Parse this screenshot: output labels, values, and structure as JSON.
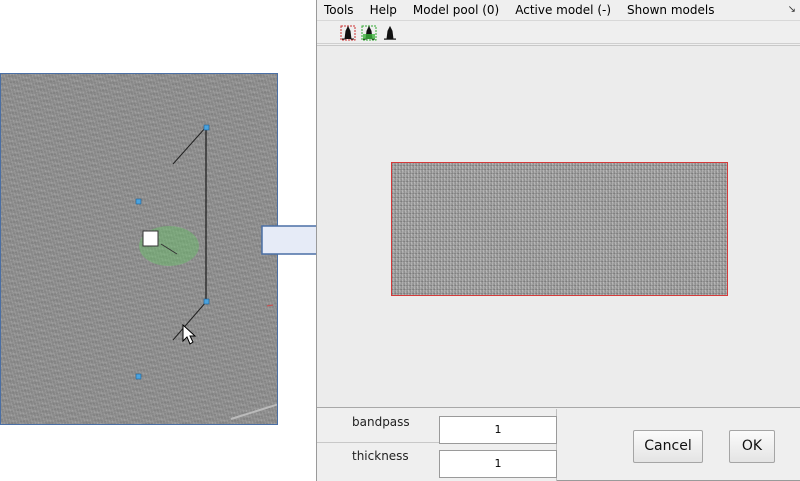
{
  "menubar": {
    "items": [
      {
        "label": "Tools"
      },
      {
        "label": "Help"
      },
      {
        "label": "Model pool (0)"
      },
      {
        "label": "Active model (-)"
      },
      {
        "label": "Shown models"
      }
    ],
    "expand_icon": "corner-arrow-icon"
  },
  "toolbar": {
    "buttons": [
      {
        "icon": "histogram-red-icon"
      },
      {
        "icon": "histogram-green-icon"
      },
      {
        "icon": "histogram-black-icon"
      }
    ]
  },
  "preview": {
    "border_color": "#d43a3a"
  },
  "params": {
    "bandpass": {
      "label": "bandpass",
      "value": "1"
    },
    "thickness": {
      "label": "thickness",
      "value": "1"
    }
  },
  "buttons": {
    "cancel": "Cancel",
    "ok": "OK"
  },
  "colors": {
    "window_bg": "#efefef",
    "view_border": "#4a6fa5",
    "arrow_fill": "#e6ebf7",
    "arrow_stroke": "#4a6fa5",
    "selection_green": "#66c266"
  }
}
